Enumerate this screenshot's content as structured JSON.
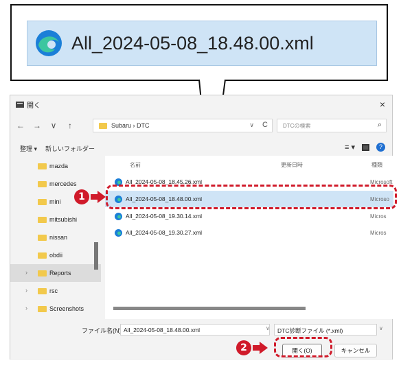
{
  "callout": {
    "filename": "All_2024-05-08_18.48.00.xml"
  },
  "dialog": {
    "title": "開く",
    "close_glyph": "×",
    "nav": {
      "back": "←",
      "forward": "→",
      "history": "∨",
      "up": "↑"
    },
    "breadcrumb": "Subaru › DTC",
    "address_dropdown": "∨",
    "refresh_glyph": "C",
    "search_placeholder": "DTCの検索",
    "search_glyph": "⌕",
    "toolbar": {
      "organize": "整理 ▾",
      "new_folder": "新しいフォルダー",
      "view": "≡ ▾",
      "help": "?"
    },
    "sidebar": [
      {
        "label": "mazda",
        "chevron": ""
      },
      {
        "label": "mercedes",
        "chevron": ""
      },
      {
        "label": "mini",
        "chevron": ""
      },
      {
        "label": "mitsubishi",
        "chevron": ""
      },
      {
        "label": "nissan",
        "chevron": ""
      },
      {
        "label": "obdii",
        "chevron": ""
      },
      {
        "label": "Reports",
        "chevron": "›",
        "selected": true
      },
      {
        "label": "rsc",
        "chevron": "›"
      },
      {
        "label": "Screenshots",
        "chevron": "›"
      }
    ],
    "columns": {
      "name": "名前",
      "modified": "更新日時",
      "type": "種類"
    },
    "files": [
      {
        "name": "All_2024-05-08_18.45.26.xml",
        "type": "Microsoft",
        "selected": false
      },
      {
        "name": "All_2024-05-08_18.48.00.xml",
        "type": "Microso",
        "selected": true
      },
      {
        "name": "All_2024-05-08_19.30.14.xml",
        "type": "Micros",
        "selected": false
      },
      {
        "name": "All_2024-05-08_19.30.27.xml",
        "type": "Micros",
        "selected": false
      }
    ],
    "filename_label": "ファイル名(N):",
    "filename_value": "All_2024-05-08_18.48.00.xml",
    "filetype_value": "DTC診断ファイル (*.xml)",
    "dropdown_glyph": "∨",
    "open_button": "開く(O)",
    "cancel_button": "キャンセル"
  },
  "annotations": {
    "marker1": "1",
    "marker2": "2",
    "color": "#d01a2a"
  },
  "colors": {
    "selection": "#cfe4f6",
    "folder": "#f2c94c"
  }
}
